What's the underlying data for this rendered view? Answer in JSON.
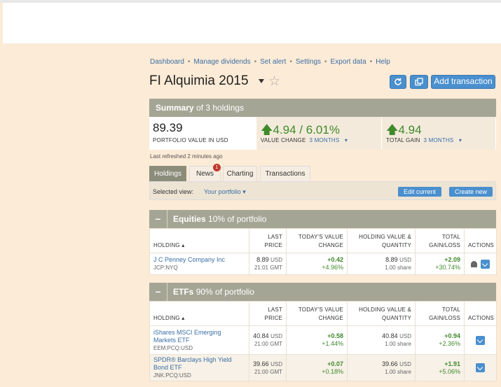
{
  "nav": {
    "items": [
      "Dashboard",
      "Manage dividends",
      "Set alert",
      "Settings",
      "Export data",
      "Help"
    ],
    "sep": "•"
  },
  "portfolio": {
    "title": "FI Alquimia 2015"
  },
  "toolbar": {
    "add_transaction": "Add transaction"
  },
  "summary": {
    "heading_bold": "Summary",
    "heading_rest": " of 3 holdings",
    "value": "89.39",
    "value_label": "PORTFOLIO VALUE IN USD",
    "change": "4.94 / 6.01%",
    "change_label": "VALUE CHANGE",
    "change_period": "3 MONTHS",
    "gain": "4.94",
    "gain_label": "TOTAL GAIN",
    "gain_period": "3 MONTHS",
    "refreshed": "Last refreshed 2 minutes ago"
  },
  "tabs": [
    {
      "label": "Holdings"
    },
    {
      "label": "News",
      "badge": "1"
    },
    {
      "label": "Charting"
    },
    {
      "label": "Transactions"
    }
  ],
  "view": {
    "label": "Selected view:",
    "value": "Your portfolio",
    "edit": "Edit current",
    "create": "Create new"
  },
  "columns": {
    "holding": "HOLDING",
    "last_price_1": "LAST",
    "last_price_2": "PRICE",
    "today_1": "TODAY'S VALUE",
    "today_2": "CHANGE",
    "holding_value_1": "HOLDING VALUE &",
    "holding_value_2": "QUANTITY",
    "total_1": "TOTAL",
    "total_2": "GAIN/LOSS",
    "actions": "ACTIONS"
  },
  "equities": {
    "title_bold": "Equities",
    "title_rest": "10% of portfolio",
    "rows": [
      {
        "name": "J C Penney Company Inc",
        "ticker": "JCP:NYQ",
        "price": "8.89",
        "currency": "USD",
        "time": "21:01 GMT",
        "chg": "+0.42",
        "chg_pct": "+4.96%",
        "value": "8.89",
        "qty": "1.00 share",
        "gain": "+2.09",
        "gain_pct": "+30.74%"
      }
    ]
  },
  "etfs": {
    "title_bold": "ETFs",
    "title_rest": "90% of portfolio",
    "rows": [
      {
        "name": "iShares MSCI Emerging Markets ETF",
        "ticker": "EEM:PCQ:USD",
        "price": "40.84",
        "currency": "USD",
        "time": "21:00 GMT",
        "chg": "+0.58",
        "chg_pct": "+1.44%",
        "value": "40.84",
        "qty": "1.00 share",
        "gain": "+0.94",
        "gain_pct": "+2.36%"
      },
      {
        "name": "SPDR® Barclays High Yield Bond ETF",
        "ticker": "JNK:PCQ:USD",
        "price": "39.66",
        "currency": "USD",
        "time": "21:00 GMT",
        "chg": "+0.07",
        "chg_pct": "+0.18%",
        "value": "39.66",
        "qty": "1.00 share",
        "gain": "+1.91",
        "gain_pct": "+5.06%"
      }
    ]
  },
  "colors": {
    "accent": "#4a8fce",
    "gain": "#3f8a2a",
    "header": "#a5a595",
    "background": "#fcebd6"
  },
  "icons": {
    "refresh": "refresh-icon",
    "copy": "copy-icon",
    "star": "star-icon",
    "bell": "bell-icon",
    "dropdown": "chevron-down-icon"
  }
}
